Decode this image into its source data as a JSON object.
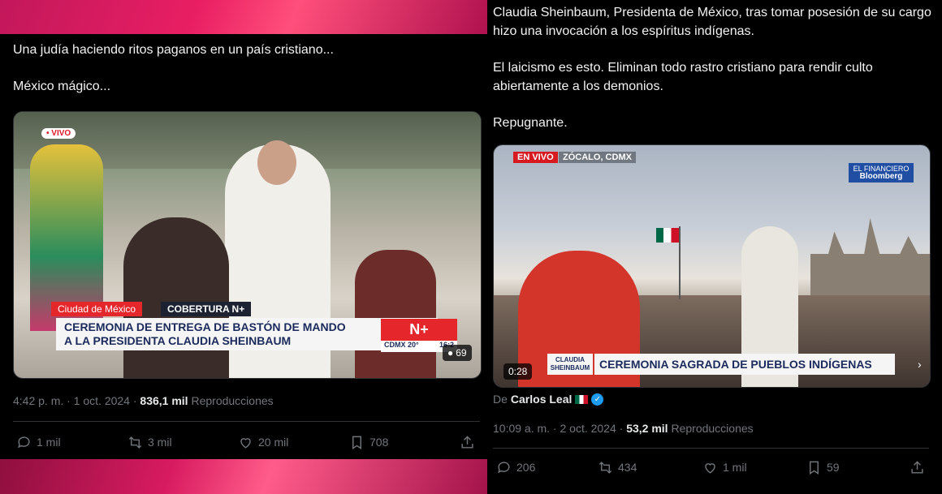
{
  "left_tweet": {
    "text_lines": [
      "Una judía haciendo ritos paganos en un país cristiano...",
      "México mágico..."
    ],
    "video": {
      "live_badge": "• VIVO",
      "location_tag": "Ciudad de México",
      "coverage_tag": "COBERTURA N+",
      "headline_line1": "CEREMONIA DE ENTREGA DE BASTÓN DE MANDO",
      "headline_line2": "A LA PRESIDENTA CLAUDIA SHEINBAUM",
      "channel_logo": "N+",
      "weather": "CDMX 20°",
      "clock": "16:2",
      "viewers": "69"
    },
    "timestamp": "4:42 p. m. · 1 oct. 2024 · ",
    "views_count": "836,1 mil",
    "views_label": " Reproducciones",
    "actions": {
      "replies": "1 mil",
      "reposts": "3 mil",
      "likes": "20 mil",
      "bookmarks": "708"
    }
  },
  "right_tweet": {
    "paragraphs": [
      "Claudia Sheinbaum, Presidenta de México, tras tomar posesión de su cargo hizo una invocación a los espíritus indígenas.",
      "El laicismo es esto. Eliminan todo rastro cristiano para rendir culto abiertamente a los demonios.",
      "Repugnante."
    ],
    "video": {
      "live_label": "EN VIVO",
      "location": "ZÓCALO, CDMX",
      "logo_line1": "EL FINANCIERO",
      "logo_line2": "Bloomberg",
      "lower_small1": "CLAUDIA",
      "lower_small2": "SHEINBAUM",
      "lower_title": "CEREMONIA SAGRADA DE PUEBLOS INDÍGENAS",
      "duration": "0:28"
    },
    "author_prefix": "De",
    "author_name": "Carlos Leal",
    "timestamp": "10:09 a. m. · 2 oct. 2024 · ",
    "views_count": "53,2 mil",
    "views_label": " Reproducciones",
    "actions": {
      "replies": "206",
      "reposts": "434",
      "likes": "1 mil",
      "bookmarks": "59"
    }
  }
}
